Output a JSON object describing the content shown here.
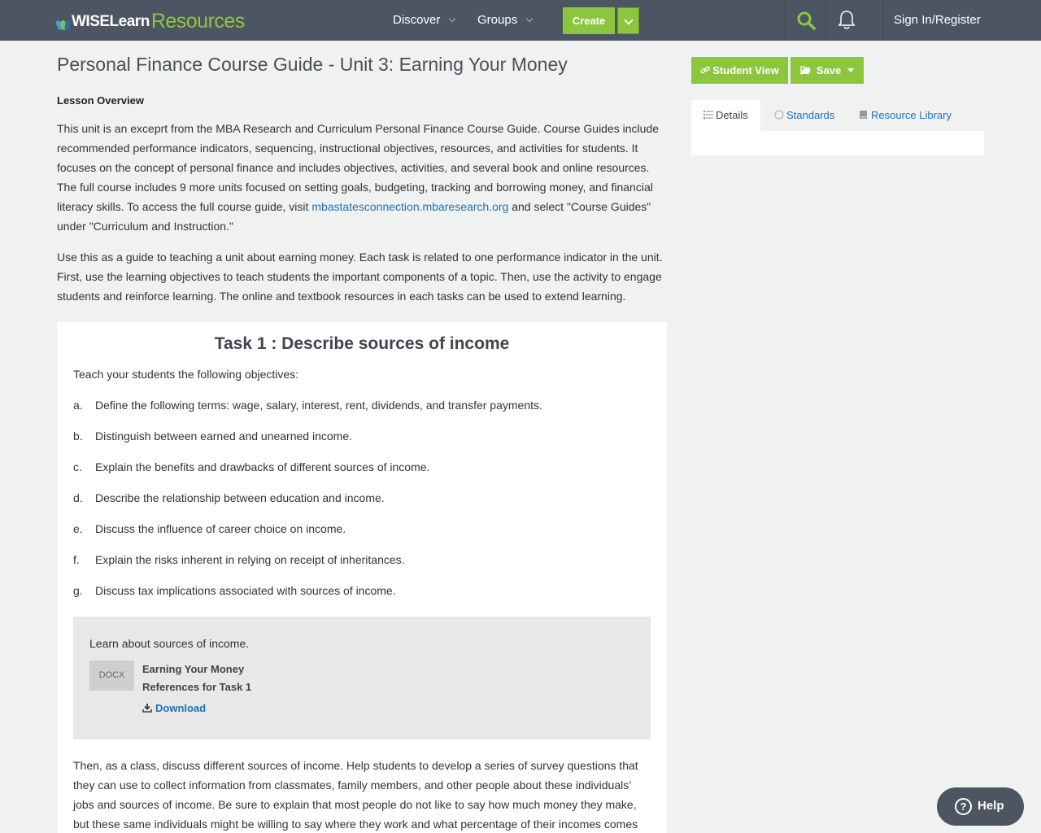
{
  "header": {
    "logo_wise": "WISELearn",
    "logo_resources": "Resources",
    "nav": [
      {
        "label": "Discover"
      },
      {
        "label": "Groups"
      }
    ],
    "create_label": "Create",
    "signin_label": "Sign In/Register"
  },
  "main": {
    "title": "Personal Finance Course Guide - Unit 3: Earning Your Money",
    "overview_label": "Lesson Overview",
    "p1_before": "This unit is an exceprt from the MBA Research and Curriculum Personal Finance Course Guide. Course Guides include recommended performance indicators, sequencing, instructional objectives, resources, and activities for students.  It focuses on the concept of personal finance and includes objectives, activities, and several book and online resources. The full course includes 9 more units focused on setting goals, budgeting, tracking and borrowing money, and financial literacy skills. To access the full course guide, visit ",
    "p1_link": "mbastatesconnection.mbaresearch.org",
    "p1_after": " and select \"Course Guides\" under \"Curriculum and Instruction.\"",
    "p2": "Use this as a guide to teaching a unit about earning money. Each task is related to one performance indicator in the unit. First, use the learning objectives to teach students the important components of a topic. Then, use the activity to engage students and reinforce learning. The online and textbook resources in each tasks can be used to extend learning."
  },
  "task": {
    "title": "Task 1 : Describe sources of income",
    "intro": "Teach your students the following objectives:",
    "objectives": [
      {
        "letter": "a.",
        "text": "Define the following terms: wage, salary, interest, rent, dividends, and transfer payments."
      },
      {
        "letter": "b.",
        "text": "Distinguish between earned and unearned income."
      },
      {
        "letter": "c.",
        "text": "Explain the benefits and drawbacks of different sources of income."
      },
      {
        "letter": "d.",
        "text": "Describe the relationship between education and income."
      },
      {
        "letter": "e.",
        "text": "Discuss the influence of career choice on income."
      },
      {
        "letter": "f.",
        "text": "Explain the risks inherent in relying on receipt of inheritances."
      },
      {
        "letter": "g.",
        "text": "Discuss tax implications associated with sources of income."
      }
    ],
    "resource": {
      "intro": "Learn about sources of income.",
      "type": "DOCX",
      "title": "Earning Your Money References for Task 1",
      "download_label": "Download"
    },
    "p3": "Then, as a class, discuss different sources of income. Help students to develop a series of survey questions that they can use to collect information from classmates, family members, and other people about these individuals’ jobs and sources of income. Be sure to explain that most people do not like to say how much money they make, but these same individuals might be willing to say where they work and what percentage of their incomes comes from wages/salaries, interest, rent,"
  },
  "sidebar": {
    "student_view_label": "Student View",
    "save_label": "Save",
    "tabs": [
      {
        "label": "Details",
        "icon": "list-icon"
      },
      {
        "label": "Standards",
        "icon": "circle-icon"
      },
      {
        "label": "Resource Library",
        "icon": "book-icon"
      }
    ]
  },
  "help": {
    "label": "Help"
  },
  "colors": {
    "brand_green": "#8cc63f",
    "header_bg": "#4d5562",
    "link": "#1f73b7"
  }
}
